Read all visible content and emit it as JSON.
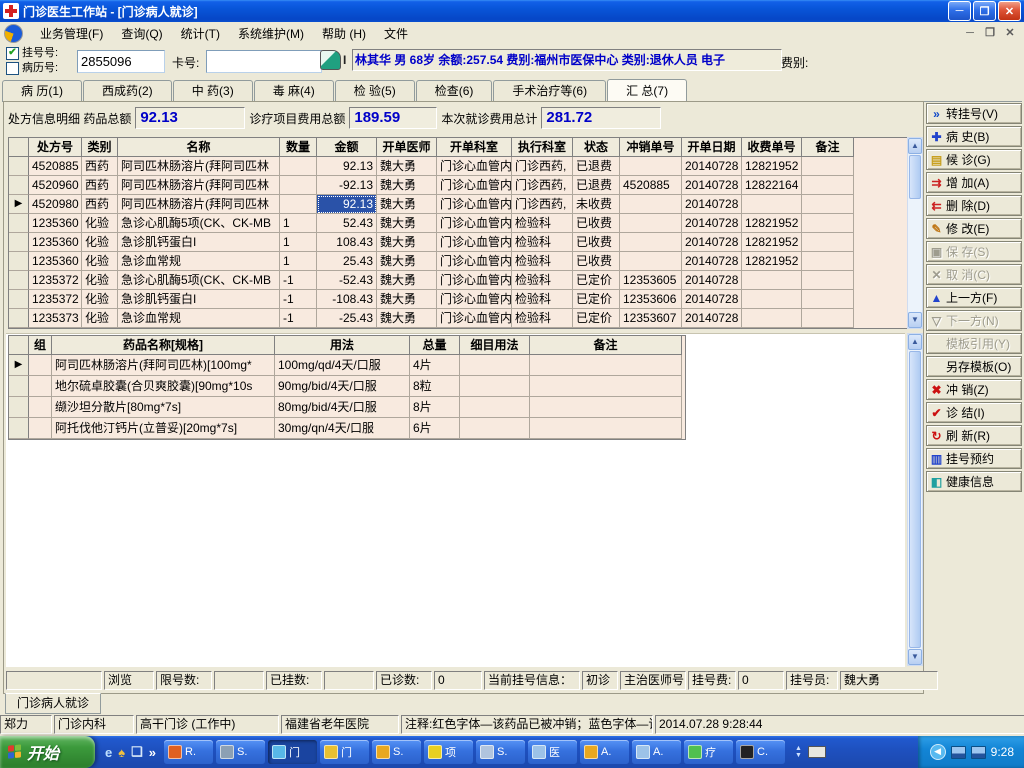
{
  "window": {
    "title": "门诊医生工作站 - [门诊病人就诊]"
  },
  "menu": {
    "items": [
      "业务管理(F)",
      "查询(Q)",
      "统计(T)",
      "系统维护(M)",
      "帮助 (H)",
      "文件"
    ]
  },
  "patient_bar": {
    "reg_label": "挂号号:",
    "case_label": "病历号:",
    "reg_checked": "✔",
    "reg_value": "2855096",
    "card_label": "卡号:",
    "card_value": "",
    "ibeam": "I",
    "info": "林其华 男 68岁 余额:257.54 费别:福州市医保中心 类别:退休人员 电子",
    "fee_label": "费别:"
  },
  "tabs": [
    {
      "label": "病 历(1)",
      "active": false
    },
    {
      "label": "西成药(2)",
      "active": false
    },
    {
      "label": "中 药(3)",
      "active": false
    },
    {
      "label": "毒 麻(4)",
      "active": false
    },
    {
      "label": "检 验(5)",
      "active": false
    },
    {
      "label": "检查(6)",
      "active": false
    },
    {
      "label": "手术治疗等(6)",
      "active": false
    },
    {
      "label": "汇 总(7)",
      "active": true
    }
  ],
  "summary": {
    "label1": "处方信息明细 药品总额",
    "drug_total": "92.13",
    "label2": "诊疗项目费用总额",
    "treat_total": "189.59",
    "label3": "本次就诊费用总计",
    "grand_total": "281.72"
  },
  "table1": {
    "headers": [
      "",
      "处方号",
      "类别",
      "名称",
      "数量",
      "金额",
      "开单医师",
      "开单科室",
      "执行科室",
      "状态",
      "冲销单号",
      "开单日期",
      "收费单号",
      "备注"
    ],
    "rows": [
      [
        "",
        "4520885",
        "西药",
        "阿司匹林肠溶片(拜阿司匹林",
        "",
        "92.13",
        "魏大勇",
        "门诊心血管内",
        "门诊西药,",
        "已退费",
        "",
        "20140728",
        "12821952",
        ""
      ],
      [
        "",
        "4520960",
        "西药",
        "阿司匹林肠溶片(拜阿司匹林",
        "",
        "-92.13",
        "魏大勇",
        "门诊心血管内",
        "门诊西药,",
        "已退费",
        "4520885",
        "20140728",
        "12822164",
        ""
      ],
      [
        "▶",
        "4520980",
        "西药",
        "阿司匹林肠溶片(拜阿司匹林",
        "",
        "92.13",
        "魏大勇",
        "门诊心血管内",
        "门诊西药,",
        "未收费",
        "",
        "20140728",
        "",
        ""
      ],
      [
        "",
        "1235360",
        "化验",
        "急诊心肌酶5项(CK、CK-MB",
        "1",
        "52.43",
        "魏大勇",
        "门诊心血管内",
        "检验科",
        "已收费",
        "",
        "20140728",
        "12821952",
        ""
      ],
      [
        "",
        "1235360",
        "化验",
        "急诊肌钙蛋白I",
        "1",
        "108.43",
        "魏大勇",
        "门诊心血管内",
        "检验科",
        "已收费",
        "",
        "20140728",
        "12821952",
        ""
      ],
      [
        "",
        "1235360",
        "化验",
        "急诊血常规",
        "1",
        "25.43",
        "魏大勇",
        "门诊心血管内",
        "检验科",
        "已收费",
        "",
        "20140728",
        "12821952",
        ""
      ],
      [
        "",
        "1235372",
        "化验",
        "急诊心肌酶5项(CK、CK-MB",
        "-1",
        "-52.43",
        "魏大勇",
        "门诊心血管内",
        "检验科",
        "已定价",
        "12353605",
        "20140728",
        "",
        ""
      ],
      [
        "",
        "1235372",
        "化验",
        "急诊肌钙蛋白I",
        "-1",
        "-108.43",
        "魏大勇",
        "门诊心血管内",
        "检验科",
        "已定价",
        "12353606",
        "20140728",
        "",
        ""
      ],
      [
        "",
        "1235373",
        "化验",
        "急诊血常规",
        "-1",
        "-25.43",
        "魏大勇",
        "门诊心血管内",
        "检验科",
        "已定价",
        "12353607",
        "20140728",
        "",
        ""
      ]
    ],
    "selected_cell": {
      "row": 2,
      "col": 5
    }
  },
  "table2": {
    "headers": [
      "",
      "组",
      "药品名称[规格]",
      "用法",
      "总量",
      "细目用法",
      "备注"
    ],
    "rows": [
      [
        "▶",
        "",
        "阿司匹林肠溶片(拜阿司匹林)[100mg*",
        "100mg/qd/4天/口服",
        "4片",
        "",
        ""
      ],
      [
        "",
        "",
        "地尔硫卓胶囊(合贝爽胶囊)[90mg*10s",
        "90mg/bid/4天/口服",
        "8粒",
        "",
        ""
      ],
      [
        "",
        "",
        "缬沙坦分散片[80mg*7s]",
        "80mg/bid/4天/口服",
        "8片",
        "",
        ""
      ],
      [
        "",
        "",
        "阿托伐他汀钙片(立普妥)[20mg*7s]",
        "30mg/qn/4天/口服",
        "6片",
        "",
        ""
      ]
    ]
  },
  "sidebar": {
    "buttons": [
      {
        "icon": "»",
        "icon_name": "double-chevron-icon",
        "color": "#1048C8",
        "label": "转挂号(V)",
        "disabled": false
      },
      {
        "icon": "✚",
        "icon_name": "plus-icon",
        "color": "#2244CC",
        "label": "病 史(B)",
        "disabled": false
      },
      {
        "icon": "▤",
        "icon_name": "page-icon",
        "color": "#C8A020",
        "label": "候 诊(G)",
        "disabled": false
      },
      {
        "icon": "⇉",
        "icon_name": "arrows-right-icon",
        "color": "#CC2222",
        "label": "增 加(A)",
        "disabled": false
      },
      {
        "icon": "⇇",
        "icon_name": "arrows-left-icon",
        "color": "#CC2222",
        "label": "删 除(D)",
        "disabled": false
      },
      {
        "icon": "✎",
        "icon_name": "pencil-icon",
        "color": "#C07818",
        "label": "修 改(E)",
        "disabled": false
      },
      {
        "icon": "▣",
        "icon_name": "floppy-icon",
        "color": "#9E9C8E",
        "label": "保 存(S)",
        "disabled": true
      },
      {
        "icon": "✕",
        "icon_name": "x-icon",
        "color": "#9E9C8E",
        "label": "取 消(C)",
        "disabled": true
      },
      {
        "icon": "▲",
        "icon_name": "up-arrow-icon",
        "color": "#2244CC",
        "label": "上一方(F)",
        "disabled": false
      },
      {
        "icon": "▽",
        "icon_name": "down-arrow-icon",
        "color": "#9E9C8E",
        "label": "下一方(N)",
        "disabled": true
      },
      {
        "icon": "",
        "icon_name": "",
        "color": "#9E9C8E",
        "label": "模板引用(Y)",
        "disabled": true
      },
      {
        "icon": "",
        "icon_name": "",
        "color": "#000000",
        "label": "另存模板(O)",
        "disabled": false
      },
      {
        "icon": "✖",
        "icon_name": "cross-icon",
        "color": "#CC1111",
        "label": "冲 销(Z)",
        "disabled": false
      },
      {
        "icon": "✔",
        "icon_name": "check-icon",
        "color": "#CC1111",
        "label": "诊 结(I)",
        "disabled": false
      },
      {
        "icon": "↻",
        "icon_name": "refresh-icon",
        "color": "#CC1111",
        "label": "刷 新(R)",
        "disabled": false
      },
      {
        "icon": "▥",
        "icon_name": "clipboard-icon",
        "color": "#2244CC",
        "label": "挂号预约",
        "disabled": false
      },
      {
        "icon": "◧",
        "icon_name": "door-icon",
        "color": "#20A0A0",
        "label": "健康信息",
        "disabled": false
      }
    ]
  },
  "inner_status": {
    "segments": [
      "",
      "浏览",
      "限号数:",
      "",
      "已挂数:",
      "",
      "已诊数:",
      "0",
      "当前挂号信息：",
      "初诊",
      "主治医师号",
      "挂号费:",
      "0",
      "挂号员:",
      "魏大勇"
    ]
  },
  "bottom_tab": "门诊病人就诊",
  "status_bar": {
    "panels": [
      "郑力",
      "门诊内科",
      "高干门诊 (工作中)",
      "福建省老年医院",
      "注释:红色字体—该药品已被冲销；蓝色字体—该",
      "2014.07.28 9:28:44"
    ]
  },
  "taskbar": {
    "start_label": "开始",
    "quick_launch": [
      "e",
      "♠",
      "❏",
      "»"
    ],
    "tasks": [
      {
        "label": "R.",
        "color": "#E06020",
        "active": false
      },
      {
        "label": "S.",
        "color": "#8CA0B4",
        "active": false
      },
      {
        "label": "门",
        "color": "#58B8E8",
        "active": true
      },
      {
        "label": "门",
        "color": "#E8C030",
        "active": false
      },
      {
        "label": "S.",
        "color": "#E8A820",
        "active": false
      },
      {
        "label": "项",
        "color": "#E8D020",
        "active": false
      },
      {
        "label": "S.",
        "color": "#B0C4DE",
        "active": false
      },
      {
        "label": "医",
        "color": "#9CC2E8",
        "active": false
      },
      {
        "label": "A.",
        "color": "#E8A820",
        "active": false
      },
      {
        "label": "A.",
        "color": "#9CC2E8",
        "active": false
      },
      {
        "label": "疗",
        "color": "#50C050",
        "active": false
      },
      {
        "label": "C.",
        "color": "#222222",
        "active": false
      }
    ],
    "clock": "9:28"
  }
}
